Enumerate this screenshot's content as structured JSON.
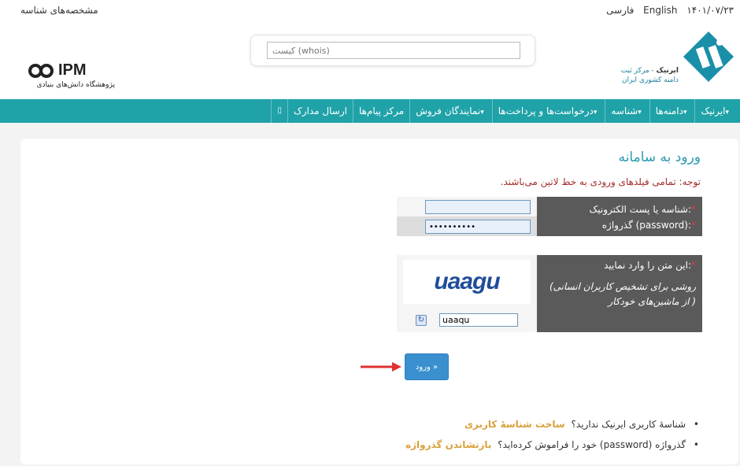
{
  "topbar": {
    "date": "۱۴۰۱/۰۷/۲۳",
    "lang_english": "English",
    "lang_farsi": "فارسی",
    "account_link": "مشخصه‌های شناسه"
  },
  "header": {
    "search_placeholder": "کیست (whois)",
    "ipm_logo_text": "IPM",
    "ipm_subtitle": "پژوهشگاه دانش‌های بنیادی",
    "irnic_name": "ایرنیک",
    "irnic_subtitle": "- مرکز ثبت",
    "irnic_subtitle2": "دامنه کشوری ایران"
  },
  "nav": {
    "items": [
      {
        "label": "ایرنیک",
        "dropdown": true
      },
      {
        "label": "دامنه‌ها",
        "dropdown": true
      },
      {
        "label": "شناسه",
        "dropdown": true
      },
      {
        "label": "درخواست‌ها و پرداخت‌ها",
        "dropdown": true
      },
      {
        "label": "نمایندگان فروش",
        "dropdown": true
      },
      {
        "label": "مرکز پیام‌ها",
        "dropdown": false
      },
      {
        "label": "ارسال مدارک",
        "dropdown": false
      }
    ],
    "extra_icon": "▯"
  },
  "login": {
    "title": "ورود به سامانه",
    "note": "توجه: تمامی فیلدهای ورودی به خط لاتین می‌باشند.",
    "user_label": "شناسه یا پست الکترونیک:",
    "password_label": "گذرواژه (password):",
    "user_value": "",
    "password_value": "••••••••••",
    "captcha_label": "این متن را وارد نمایید:",
    "captcha_hint": "(روشی برای تشخیص کاربران انسانی از ماشین‌های خودکار )",
    "captcha_text": "uaagu",
    "captcha_input": "uaaqu",
    "required_mark": "*",
    "button_label": "ورود »"
  },
  "links": {
    "no_account_text": "شناسهٔ کاربری ایرنیک ندارید؟",
    "no_account_link": "ساخت شناسهٔ کاربری",
    "forgot_text": "گذرواژه (password) خود را فراموش کرده‌اید؟",
    "forgot_link": "بازنشاندن گذرواژه"
  },
  "colors": {
    "nav_bg": "#1fa2a8",
    "title": "#2a9bb0",
    "note": "#a52a2a",
    "link": "#d8a03a",
    "button": "#3a8fcf",
    "label_bg": "#5a5a5a"
  }
}
